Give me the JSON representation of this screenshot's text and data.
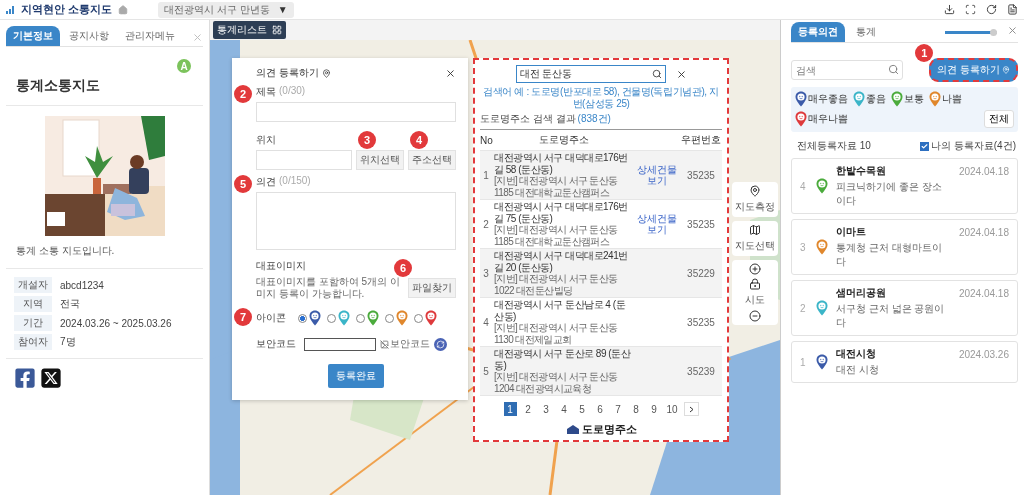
{
  "header": {
    "title": "지역현안 소통지도",
    "region": "대전광역시 서구 만년동",
    "caret": "▼"
  },
  "left_panel": {
    "tabs": [
      {
        "label": "기본정보",
        "selected": true
      },
      {
        "label": "공지사항",
        "selected": false
      },
      {
        "label": "관리자메뉴",
        "selected": false
      }
    ],
    "avatar": "A",
    "title": "통계소통지도",
    "description": "통계 소통 지도입니다.",
    "info": [
      {
        "label": "개설자",
        "value": "abcd1234"
      },
      {
        "label": "지역",
        "value": "전국"
      },
      {
        "label": "기간",
        "value": "2024.03.26 ~ 2025.03.26"
      },
      {
        "label": "참여자",
        "value": "7명"
      }
    ]
  },
  "map": {
    "list_button": "통계리스트",
    "controls": [
      {
        "kind": "measure",
        "label": "지도측정"
      },
      {
        "kind": "select",
        "label": "지도선택"
      }
    ],
    "zoom_label": "시도"
  },
  "form": {
    "title": "의견 등록하기",
    "subject": {
      "label": "제목",
      "counter": "(0/30)",
      "badge": "2"
    },
    "location": {
      "label": "위치",
      "buttons": [
        {
          "label": "위치선택",
          "badge": "3"
        },
        {
          "label": "주소선택",
          "badge": "4"
        }
      ]
    },
    "opinion": {
      "label": "의견",
      "counter": "(0/150)",
      "badge": "5"
    },
    "image": {
      "label": "대표이미지",
      "help": "대표이미지를 포함하여 5개의 이미지 등록이 가능합니다.",
      "button": "파일찾기",
      "badge": "6"
    },
    "icon": {
      "label": "아이콘",
      "badge": "7",
      "options": [
        {
          "color": "#3b5ba9",
          "selected": true
        },
        {
          "color": "#3bb5c8",
          "selected": false
        },
        {
          "color": "#4bab3c",
          "selected": false
        },
        {
          "color": "#e0872c",
          "selected": false
        },
        {
          "color": "#de3a3c",
          "selected": false
        }
      ]
    },
    "captcha": {
      "label": "보안코드",
      "image_alt": "보안코드"
    },
    "submit": "등록완료"
  },
  "address_search": {
    "highlighted": true,
    "query": "대전 둔산동",
    "hint": "검색어 예 : 도로명(반포대로 58), 건물명(독립기념관), 지번(삼성동 25)",
    "result_label": "도로명주소 검색 결과",
    "result_count": "(838건)",
    "columns": [
      "No",
      "도로명주소",
      "우편번호"
    ],
    "rows": [
      {
        "no": "1",
        "road": "대전광역시 서구 대덕대로176번길 58 (둔산동)",
        "jibun": "[지번] 대전광역시 서구 둔산동 1185 대전대학교둔산캠퍼스",
        "link": "상세건물 보기",
        "zip": "35235"
      },
      {
        "no": "2",
        "road": "대전광역시 서구 대덕대로176번길 75 (둔산동)",
        "jibun": "[지번] 대전광역시 서구 둔산동 1185 대전대학교둔산캠퍼스",
        "link": "상세건물 보기",
        "zip": "35235"
      },
      {
        "no": "3",
        "road": "대전광역시 서구 대덕대로241번길 20 (둔산동)",
        "jibun": "[지번] 대전광역시 서구 둔산동 1022 대전둔산빌딩",
        "zip": "35229"
      },
      {
        "no": "4",
        "road": "대전광역시 서구 둔산남로 4 (둔산동)",
        "jibun": "[지번] 대전광역시 서구 둔산동 1130 대전제일교회",
        "zip": "35235"
      },
      {
        "no": "5",
        "road": "대전광역시 서구 둔산로 89 (둔산동)",
        "jibun": "[지번] 대전광역시 서구 둔산동 1204 대전광역시교육청",
        "zip": "35239"
      }
    ],
    "pages": [
      {
        "label": "1",
        "selected": true
      },
      {
        "label": "2",
        "selected": false
      },
      {
        "label": "3",
        "selected": false
      },
      {
        "label": "4",
        "selected": false
      },
      {
        "label": "5",
        "selected": false
      },
      {
        "label": "6",
        "selected": false
      },
      {
        "label": "7",
        "selected": false
      },
      {
        "label": "8",
        "selected": false
      },
      {
        "label": "9",
        "selected": false
      },
      {
        "label": "10",
        "selected": false
      }
    ],
    "logo": "도로명주소"
  },
  "right_panel": {
    "tabs": [
      {
        "label": "등록의견",
        "selected": true
      },
      {
        "label": "통계",
        "selected": false
      }
    ],
    "slider": {
      "level": 0.92
    },
    "search_placeholder": "검색",
    "register_button": {
      "label": "의견 등록하기",
      "badge": "1",
      "highlighted": true
    },
    "legend": [
      {
        "label": "매우좋음",
        "color": "#3b5ba9"
      },
      {
        "label": "좋음",
        "color": "#3bb5c8"
      },
      {
        "label": "보통",
        "color": "#4bab3c"
      },
      {
        "label": "나쁨",
        "color": "#e0872c"
      },
      {
        "label": "매우나쁨",
        "color": "#de3a3c"
      }
    ],
    "legend_all": "전체",
    "total": "전체등록자료 10",
    "mine": {
      "label": "나의 등록자료(4건)",
      "checked": true
    },
    "items": [
      {
        "no": "4",
        "title": "한밭수목원",
        "desc": "피크닉하기에 좋은 장소이다",
        "date": "2024.04.18",
        "color": "#4bab3c"
      },
      {
        "no": "3",
        "title": "이마트",
        "desc": "통계청 근처 대형마트이다",
        "date": "2024.04.18",
        "color": "#e0872c"
      },
      {
        "no": "2",
        "title": "샘머리공원",
        "desc": "서구청 근처 넓은 공원이다",
        "date": "2024.04.18",
        "color": "#3bb5c8"
      },
      {
        "no": "1",
        "title": "대전시청",
        "desc": "대전 시청",
        "date": "2024.03.26",
        "color": "#3b5ba9"
      }
    ]
  }
}
